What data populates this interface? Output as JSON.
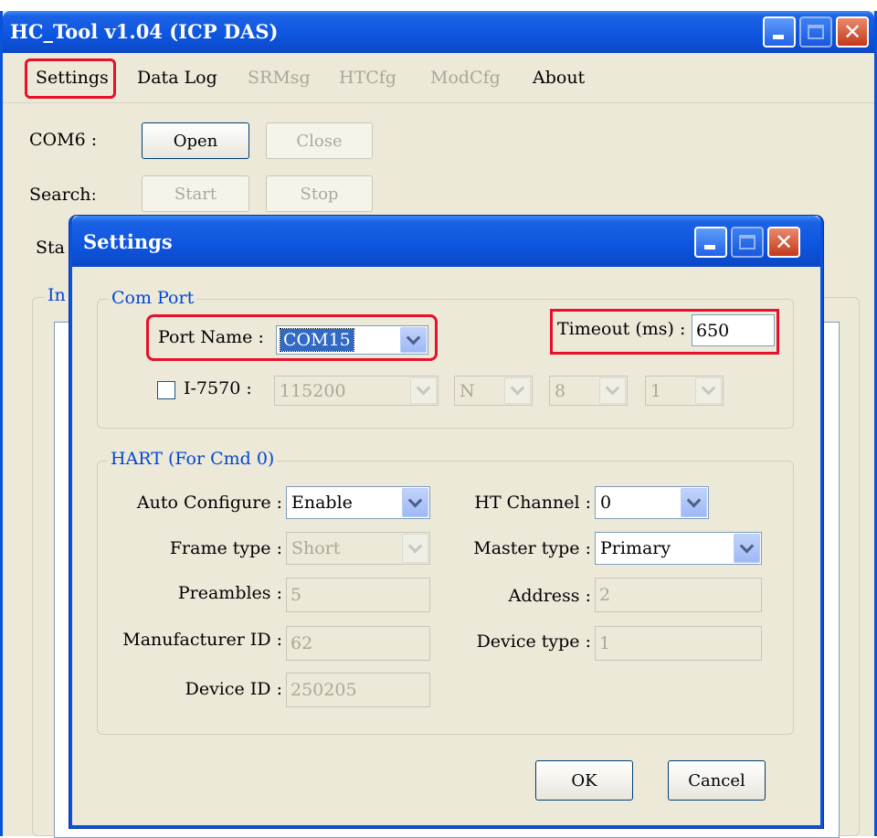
{
  "main_window": {
    "title": "HC_Tool v1.04  (ICP DAS)",
    "menu": [
      "Settings",
      "Data Log",
      "SRMsg",
      "HTCfg",
      "ModCfg",
      "About"
    ],
    "com_label": "COM6 :",
    "open_label": "Open",
    "close_label": "Close",
    "search_label": "Searchː",
    "start_label": "Start",
    "stop_label": "Stop",
    "status_label_partial": "Sta",
    "info_group_partial": "In"
  },
  "dialog": {
    "title": "Settings",
    "com_port": {
      "legend": "Com Port",
      "port_name_label": "Port Name :",
      "port_name_value": "COM15",
      "timeout_label": "Timeout (ms) :",
      "timeout_value": "650",
      "i7570_label": "I-7570 :",
      "i7570_checked": false,
      "baud_value": "115200",
      "parity_value": "N",
      "data_bits_value": "8",
      "stop_bits_value": "1"
    },
    "hart": {
      "legend": "HART (For Cmd 0)",
      "auto_configure_label": "Auto Configure :",
      "auto_configure_value": "Enable",
      "ht_channel_label": "HT Channel :",
      "ht_channel_value": "0",
      "frame_type_label": "Frame type :",
      "frame_type_value": "Short",
      "master_type_label": "Master type :",
      "master_type_value": "Primary",
      "preambles_label": "Preambles :",
      "preambles_value": "5",
      "address_label": "Address :",
      "address_value": "2",
      "manufacturer_id_label": "Manufacturer ID :",
      "manufacturer_id_value": "62",
      "device_type_label": "Device type :",
      "device_type_value": "1",
      "device_id_label": "Device ID :",
      "device_id_value": "250205"
    },
    "ok_label": "OK",
    "cancel_label": "Cancel"
  },
  "colors": {
    "titlebar_blue": "#0d55de",
    "window_face": "#ece9d8",
    "group_legend": "#0046d5",
    "highlight_red": "#e8102a",
    "selection_blue": "#316ac5",
    "disabled_text": "#aca899"
  }
}
